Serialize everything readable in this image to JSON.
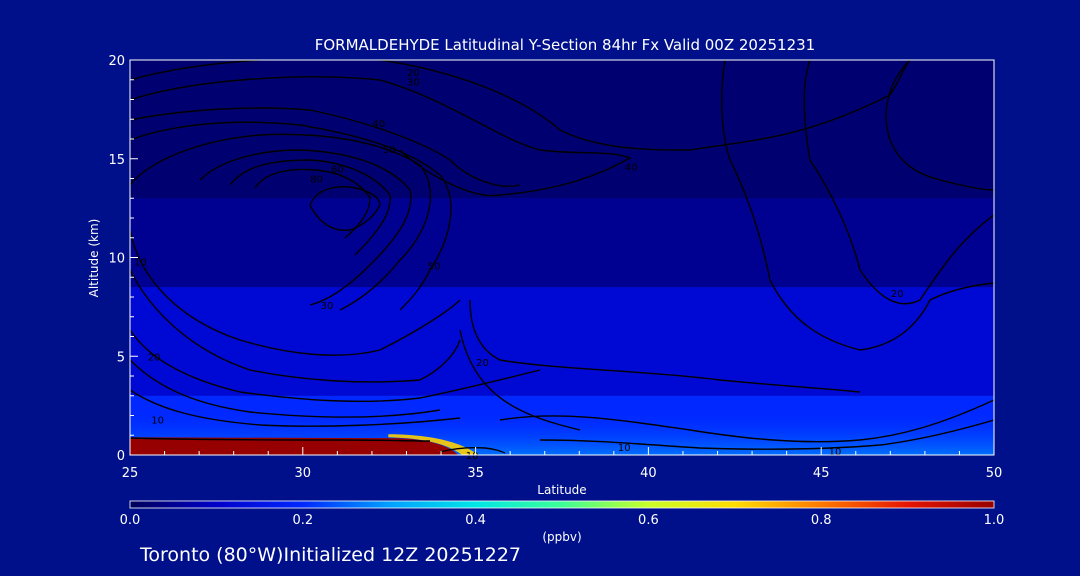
{
  "page": {
    "background": "#00108a",
    "footer_text": "Toronto (80°W)Initialized 12Z 20251227"
  },
  "chart_data": {
    "type": "heatmap",
    "title": "FORMALDEHYDE Latitudinal Y-Section 84hr  Fx Valid 00Z 20251231",
    "xlabel": "Latitude",
    "ylabel": "Altitude (km)",
    "xlim": [
      25,
      50
    ],
    "ylim": [
      0,
      20
    ],
    "x_ticks": [
      25,
      30,
      35,
      40,
      45,
      50
    ],
    "y_ticks": [
      0,
      5,
      10,
      15,
      20
    ],
    "grid": false,
    "colorbar": {
      "label": "(ppbv)",
      "min": 0.0,
      "max": 1.0,
      "ticks": [
        "0.0",
        "0.2",
        "0.4",
        "0.6",
        "0.8",
        "1.0"
      ],
      "colors": [
        "#00005a",
        "#0000c8",
        "#0028ff",
        "#00a0ff",
        "#00e6e6",
        "#3cff96",
        "#c8ff28",
        "#ffdc00",
        "#ff7800",
        "#e61400",
        "#960000"
      ]
    },
    "field": {
      "description_levels": "approx formaldehyde mixing ratio (ppbv) by layer",
      "layers": [
        {
          "alt_top": 20,
          "alt_bottom": 13,
          "value": 0.02
        },
        {
          "alt_top": 13,
          "alt_bottom": 8.5,
          "value": 0.05
        },
        {
          "alt_top": 8.5,
          "alt_bottom": 3,
          "value": 0.12
        },
        {
          "alt_top": 3,
          "alt_bottom": 0,
          "value": 0.2
        }
      ],
      "hotspot": {
        "lat_start": 25,
        "lat_end": 34.5,
        "alt_top": 0.9,
        "value": 1.0
      }
    },
    "contour_labels": [
      {
        "text": "20",
        "lat": 33.2,
        "alt": 19.4
      },
      {
        "text": "30",
        "lat": 33.2,
        "alt": 18.9
      },
      {
        "text": "40",
        "lat": 32.2,
        "alt": 16.8
      },
      {
        "text": "50",
        "lat": 32.5,
        "alt": 15.5
      },
      {
        "text": "60",
        "lat": 31.0,
        "alt": 14.5
      },
      {
        "text": "80",
        "lat": 30.4,
        "alt": 14.0
      },
      {
        "text": "40",
        "lat": 39.5,
        "alt": 14.6
      },
      {
        "text": "50",
        "lat": 33.8,
        "alt": 9.6
      },
      {
        "text": "10",
        "lat": 25.3,
        "alt": 9.8
      },
      {
        "text": "30",
        "lat": 30.7,
        "alt": 7.6
      },
      {
        "text": "20",
        "lat": 25.7,
        "alt": 5.0
      },
      {
        "text": "20",
        "lat": 35.2,
        "alt": 4.7
      },
      {
        "text": "10",
        "lat": 25.8,
        "alt": 1.8
      },
      {
        "text": "10",
        "lat": 34.9,
        "alt": 0.0
      },
      {
        "text": "10",
        "lat": 39.3,
        "alt": 0.4
      },
      {
        "text": "10",
        "lat": 45.4,
        "alt": 0.2
      },
      {
        "text": "20",
        "lat": 47.2,
        "alt": 8.2
      }
    ]
  }
}
